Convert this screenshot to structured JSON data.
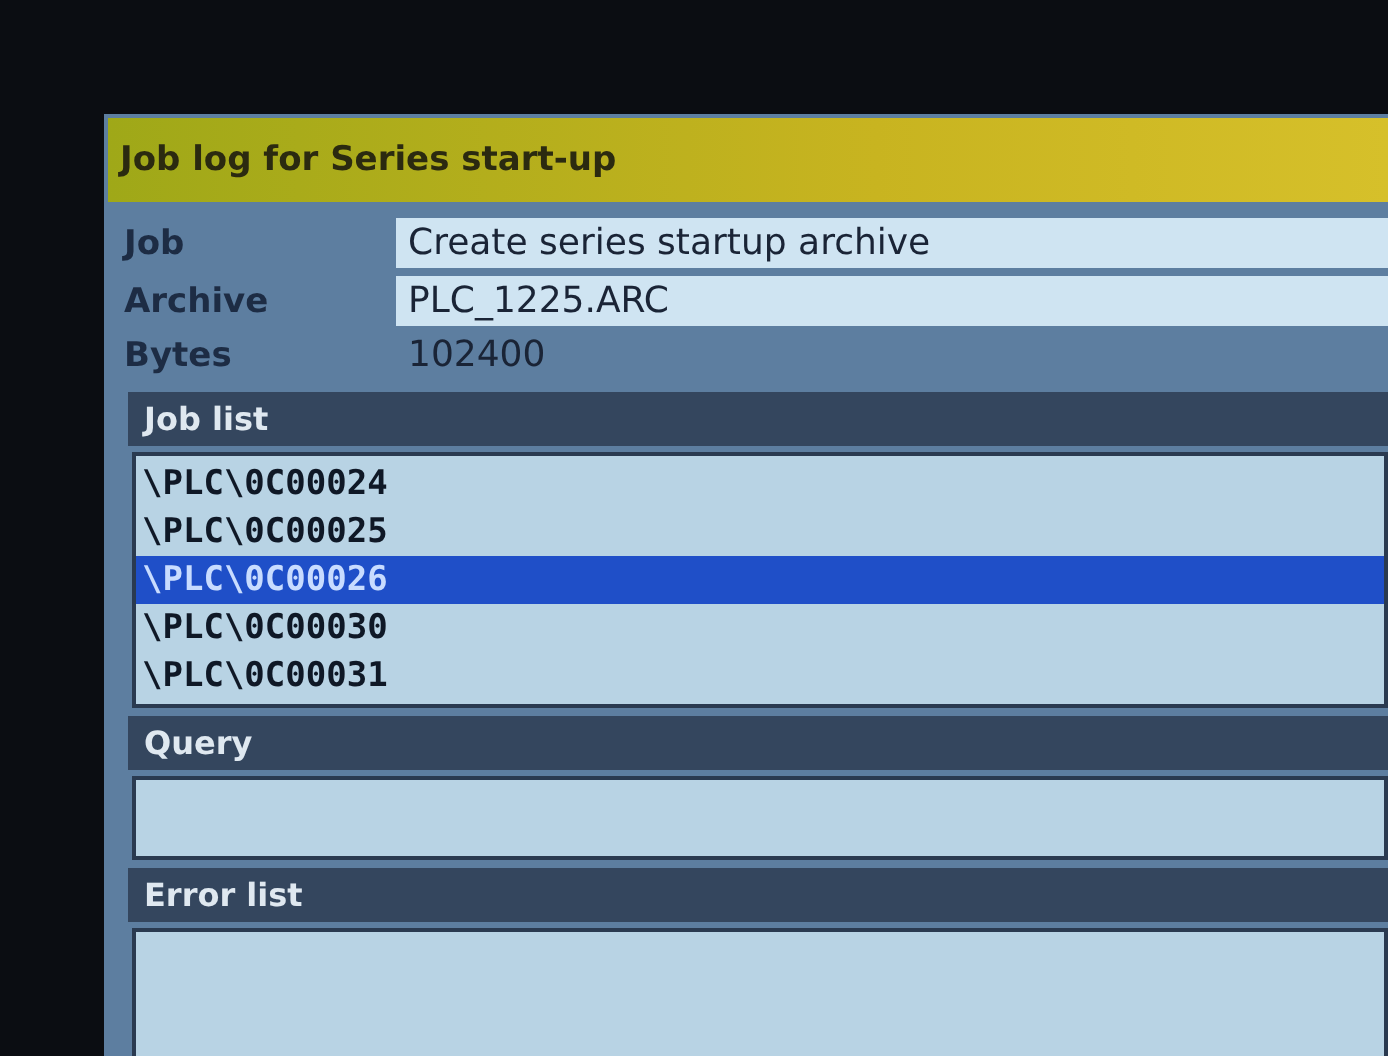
{
  "window": {
    "title": "Job log for Series start-up"
  },
  "fields": [
    {
      "label": "Job",
      "value": "Create series startup archive",
      "kind": "box"
    },
    {
      "label": "Archive",
      "value": "PLC_1225.ARC",
      "kind": "box"
    },
    {
      "label": "Bytes",
      "value": "102400",
      "kind": "plain"
    }
  ],
  "job_list": {
    "heading": "Job list",
    "items": [
      {
        "text": "\\PLC\\0C00024",
        "selected": false
      },
      {
        "text": "\\PLC\\0C00025",
        "selected": false
      },
      {
        "text": "\\PLC\\0C00026",
        "selected": true
      },
      {
        "text": "\\PLC\\0C00030",
        "selected": false
      },
      {
        "text": "\\PLC\\0C00031",
        "selected": false
      }
    ]
  },
  "query": {
    "heading": "Query"
  },
  "error_list": {
    "heading": "Error list"
  }
}
